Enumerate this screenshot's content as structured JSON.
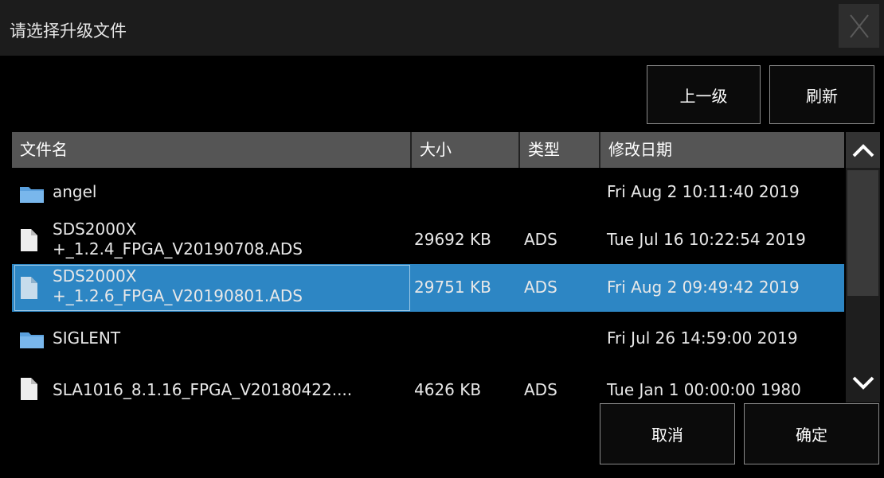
{
  "dialog": {
    "title": "请选择升级文件",
    "close_icon": "close-icon"
  },
  "toolbar": {
    "up_label": "上一级",
    "refresh_label": "刷新"
  },
  "columns": {
    "name": "文件名",
    "size": "大小",
    "type": "类型",
    "date": "修改日期"
  },
  "files": [
    {
      "icon": "folder-icon",
      "name": "angel",
      "size": "",
      "type": "",
      "date": "Fri Aug 2 10:11:40 2019"
    },
    {
      "icon": "file-icon",
      "name_line1": "SDS2000X",
      "name_line2": "+_1.2.4_FPGA_V20190708.ADS",
      "size": "29692 KB",
      "type": "ADS",
      "date": "Tue Jul 16 10:22:54 2019"
    },
    {
      "icon": "file-icon",
      "name_line1": "SDS2000X",
      "name_line2": "+_1.2.6_FPGA_V20190801.ADS",
      "size": "29751 KB",
      "type": "ADS",
      "date": "Fri Aug 2 09:49:42 2019",
      "selected": true
    },
    {
      "icon": "folder-icon",
      "name": "SIGLENT",
      "size": "",
      "type": "",
      "date": "Fri Jul 26 14:59:00 2019"
    },
    {
      "icon": "file-icon",
      "name": "SLA1016_8.1.16_FPGA_V20180422....",
      "size": "4626 KB",
      "type": "ADS",
      "date": "Tue Jan 1 00:00:00 1980"
    }
  ],
  "footer": {
    "cancel_label": "取消",
    "ok_label": "确定"
  },
  "colors": {
    "selection": "#2d86c4",
    "header_bg": "#555555",
    "folder": "#5aa0dd"
  }
}
